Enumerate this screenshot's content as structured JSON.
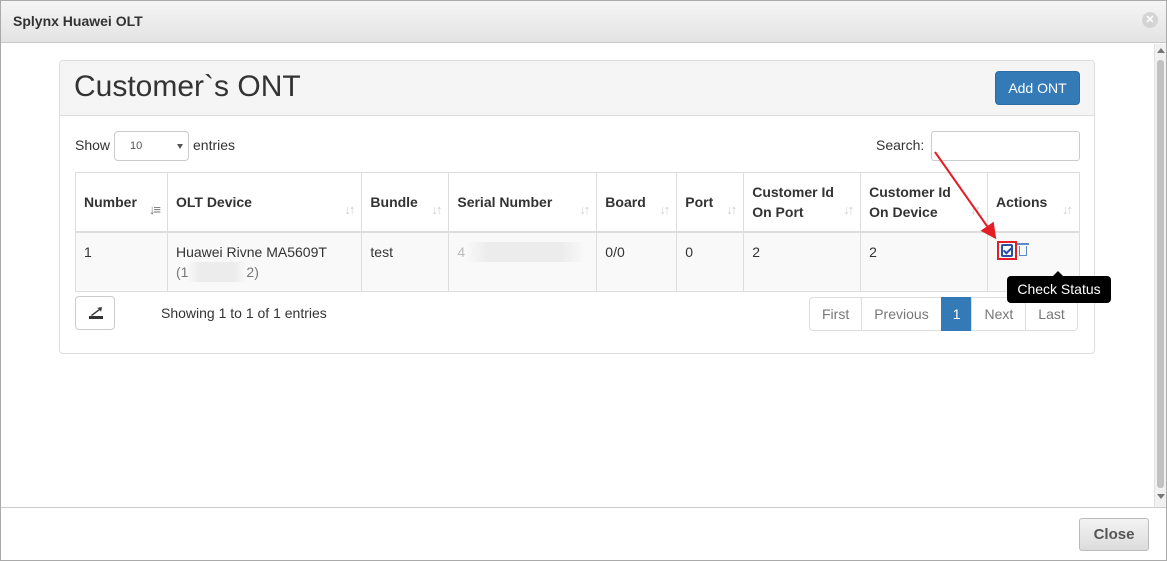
{
  "window": {
    "title": "Splynx Huawei OLT"
  },
  "panel": {
    "title": "Customer`s ONT",
    "add_button": "Add ONT"
  },
  "length": {
    "show_label": "Show",
    "value": "10",
    "entries_label": "entries"
  },
  "search": {
    "label": "Search:",
    "value": ""
  },
  "table": {
    "headers": [
      {
        "label": "Number",
        "sorted": true
      },
      {
        "label": "OLT Device",
        "sorted": false
      },
      {
        "label": "Bundle",
        "sorted": false
      },
      {
        "label": "Serial Number",
        "sorted": false
      },
      {
        "label": "Board",
        "sorted": false
      },
      {
        "label": "Port",
        "sorted": false
      },
      {
        "label": "Customer Id On Port",
        "sorted": false
      },
      {
        "label": "Customer Id On Device",
        "sorted": false
      },
      {
        "label": "Actions",
        "sorted": false
      }
    ],
    "rows": [
      {
        "number": "1",
        "olt_device": "Huawei Rivne MA5609T",
        "olt_ip_start": "(1",
        "olt_ip_end": "2)",
        "bundle": "test",
        "serial_start": "4",
        "board": "0/0",
        "port": "0",
        "customer_id_on_port": "2",
        "customer_id_on_device": "2"
      }
    ]
  },
  "tooltip": "Check Status",
  "info": "Showing 1 to 1 of 1 entries",
  "pager": {
    "first": "First",
    "previous": "Previous",
    "current": "1",
    "next": "Next",
    "last": "Last"
  },
  "footer": {
    "close_label": "Close"
  },
  "colors": {
    "primary": "#337ab7",
    "highlight": "#e21f26"
  }
}
